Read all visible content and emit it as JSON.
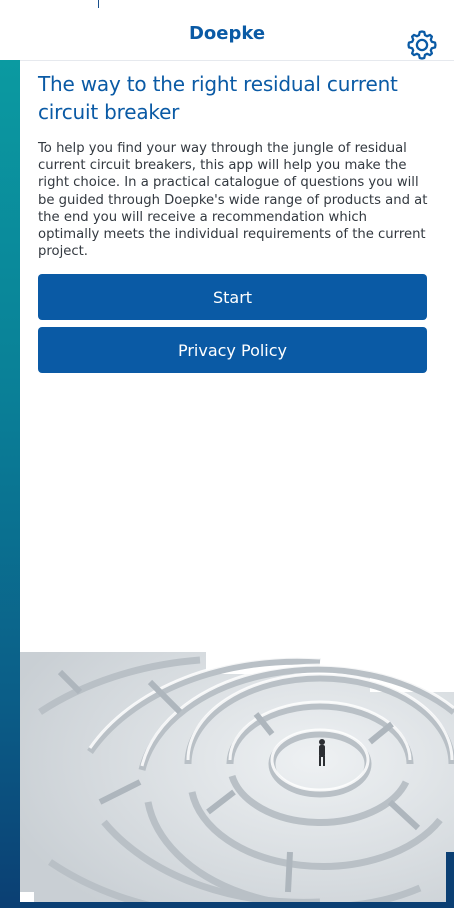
{
  "nav": {
    "title": "Doepke",
    "settings_icon": "gear-icon"
  },
  "main": {
    "headline": "The way to the right residual current circuit breaker",
    "intro": "To help you find your way through the jungle of residual current circuit breakers, this app will help you make the right choice. In a practical catalogue of questions you will be guided through Doepke's wide range of products and at the end you will receive a recommendation which optimally meets the individual requirements of the current project."
  },
  "buttons": {
    "start_label": "Start",
    "privacy_label": "Privacy Policy"
  },
  "colors": {
    "brand_blue": "#0a5aa5",
    "teal_bar": "#0b9aa1",
    "dark_navy": "#0b3f73"
  }
}
